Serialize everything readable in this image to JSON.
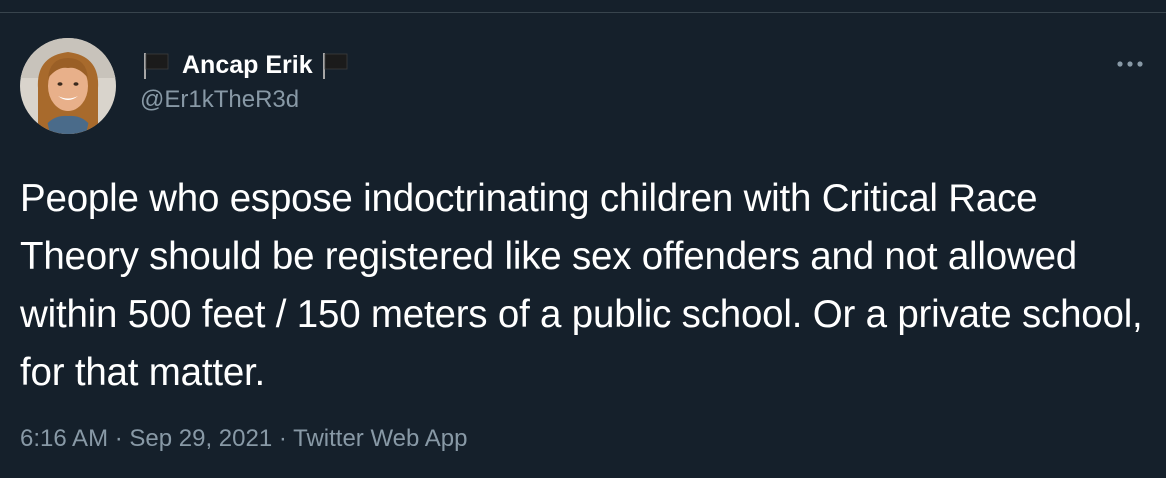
{
  "tweet": {
    "author": {
      "display_name": "Ancap Erik",
      "handle": "@Er1kTheR3d",
      "flag_icon": "black-flag"
    },
    "text": "People who espose indoctrinating children with Critical Race Theory should be registered like sex offenders and not allowed within 500 feet / 150 meters of a public school. Or a private school, for that matter.",
    "time": "6:16 AM",
    "date": "Sep 29, 2021",
    "separator": "·",
    "source": "Twitter Web App"
  },
  "colors": {
    "background": "#15202b",
    "primary_text": "#ffffff",
    "secondary_text": "#8899a6",
    "border": "#38444d"
  },
  "icons": {
    "more": "more-horizontal-icon",
    "flag": "black-flag-icon"
  }
}
